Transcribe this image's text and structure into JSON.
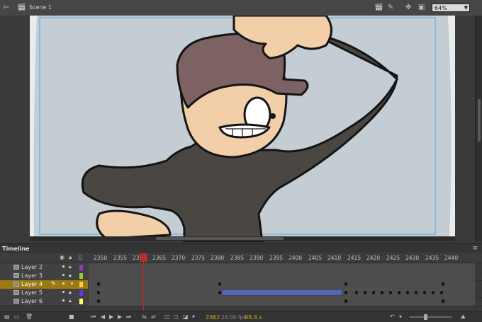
{
  "topbar": {
    "scene_label": "Scene 1",
    "zoom_value": "64%"
  },
  "timeline": {
    "tab_label": "Timeline",
    "ruler_numbers": [
      "2350",
      "2355",
      "2360",
      "2365",
      "2370",
      "2375",
      "2380",
      "2385",
      "2390",
      "2395",
      "2400",
      "2405",
      "2410",
      "2415",
      "2420",
      "2425",
      "2430",
      "2435",
      "2440"
    ],
    "layers": [
      {
        "name": "Layer 2",
        "swatch": "#9933cc",
        "active": false
      },
      {
        "name": "Layer 3",
        "swatch": "#99cc33",
        "active": false
      },
      {
        "name": "Layer 4",
        "swatch": "#ffcc33",
        "active": true
      },
      {
        "name": "Layer 5",
        "swatch": "#6633ff",
        "active": false
      },
      {
        "name": "Layer 6",
        "swatch": "#ffff66",
        "active": false
      }
    ]
  },
  "bottombar": {
    "current_frame": "2362",
    "fps": "24.00 fps",
    "elapsed_time": "98.4 s"
  },
  "colors": {
    "stage_bg": "#c3cdd3",
    "active_layer": "#9c7a12",
    "playhead": "#cc2222"
  }
}
